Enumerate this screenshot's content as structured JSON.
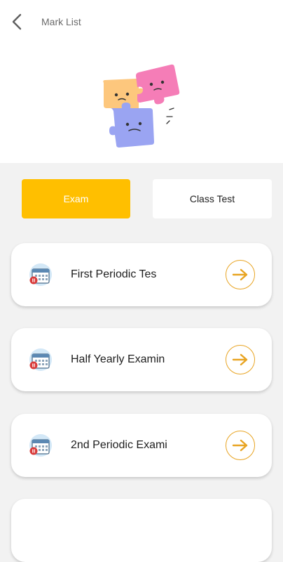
{
  "header": {
    "title": "Mark List",
    "back_icon": "chevron-left-icon",
    "illustration": "sad-puzzle-pieces"
  },
  "tabs": [
    {
      "label": "Exam",
      "selected": true
    },
    {
      "label": "Class Test",
      "selected": false
    }
  ],
  "exams": [
    {
      "label": "First Periodic Tes",
      "icon": "calendar-icon",
      "action_icon": "arrow-right-icon"
    },
    {
      "label": "Half Yearly Examin",
      "icon": "calendar-icon",
      "action_icon": "arrow-right-icon"
    },
    {
      "label": "2nd Periodic Exami",
      "icon": "calendar-icon",
      "action_icon": "arrow-right-icon"
    }
  ],
  "colors": {
    "accent": "#ffbf00",
    "arrow": "#e8a422",
    "background": "#f2f2f2"
  }
}
